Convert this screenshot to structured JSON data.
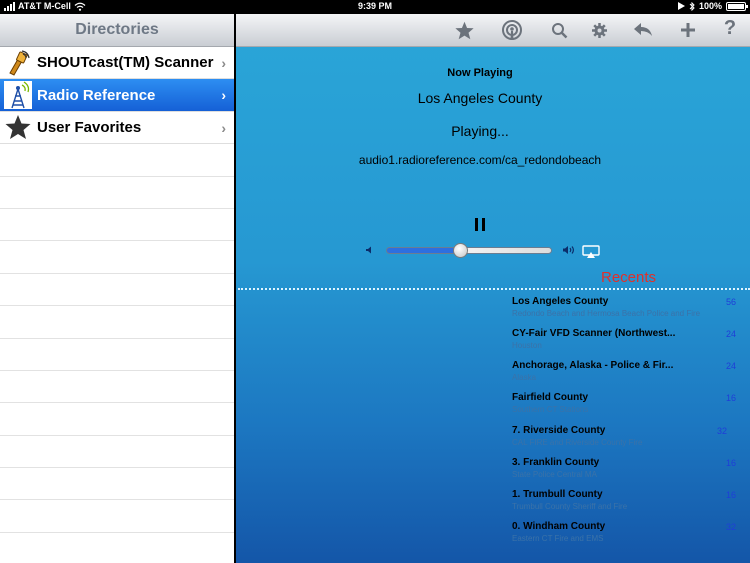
{
  "status_bar": {
    "carrier": "AT&T M-Cell",
    "time": "9:39 PM",
    "battery": "100%"
  },
  "directories": {
    "title": "Directories",
    "items": [
      {
        "label": "SHOUTcast(TM) Scanner",
        "icon": "scanner-icon",
        "selected": false
      },
      {
        "label": "Radio Reference",
        "icon": "radio-tower-icon",
        "selected": true
      },
      {
        "label": "User Favorites",
        "icon": "star-icon",
        "selected": false
      }
    ]
  },
  "toolbar": {
    "buttons": [
      "star-icon",
      "podcast-icon",
      "search-icon",
      "gear-icon",
      "back-arrow-icon",
      "plus-icon",
      "help-icon"
    ],
    "help_label": "?"
  },
  "now_playing": {
    "heading": "Now Playing",
    "station": "Los Angeles County",
    "status": "Playing...",
    "url": "audio1.radioreference.com/ca_redondobeach",
    "volume": 0.45
  },
  "recents": {
    "title": "Recents",
    "items": [
      {
        "name": "Los Angeles County",
        "sub": "Redondo Beach and Hermosa Beach Police and Fire",
        "count": "56"
      },
      {
        "name": "CY-Fair VFD Scanner (Northwest...",
        "sub": "Houston",
        "count": "24"
      },
      {
        "name": "Anchorage, Alaska - Police & Fir...",
        "sub": "Alaska",
        "count": "24"
      },
      {
        "name": "Fairfield County",
        "sub": "Southern CT Stations",
        "count": "16"
      },
      {
        "name": "7. Riverside County",
        "sub": "CAL FIRE and Riverside County Fire",
        "count": "32"
      },
      {
        "name": "3. Franklin County",
        "sub": "State Police Central MA",
        "count": "16"
      },
      {
        "name": "1. Trumbull County",
        "sub": "Trumbull County Sheriff and Fire",
        "count": "16"
      },
      {
        "name": "0. Windham County",
        "sub": "Eastern CT Fire and EMS",
        "count": "32"
      }
    ]
  },
  "colors": {
    "selected_row": "#1b6fe3",
    "recents_title": "#e0302a",
    "count_text": "#1f3ed8"
  }
}
